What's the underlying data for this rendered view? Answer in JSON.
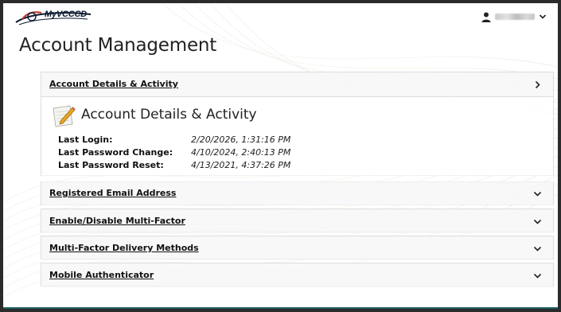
{
  "header": {
    "logo_text": "MyVCCCD",
    "user_name": "user_name_redacted"
  },
  "page": {
    "title": "Account Management"
  },
  "sections": [
    {
      "label": "Account Details & Activity",
      "expanded": true
    },
    {
      "label": "Registered Email Address",
      "expanded": false
    },
    {
      "label": "Enable/Disable Multi-Factor",
      "expanded": false
    },
    {
      "label": "Multi-Factor Delivery Methods",
      "expanded": false
    },
    {
      "label": "Mobile Authenticator",
      "expanded": false
    }
  ],
  "details": {
    "title": "Account Details & Activity",
    "rows": [
      {
        "label": "Last Login:",
        "value": "2/20/2026, 1:31:16 PM"
      },
      {
        "label": "Last Password Change:",
        "value": "4/10/2024, 2:40:13 PM"
      },
      {
        "label": "Last Password Reset:",
        "value": "4/13/2021, 4:37:26 PM"
      }
    ]
  },
  "icons": {
    "user": "user-icon",
    "chevron_down": "chevron-down-icon",
    "chevron_right": "chevron-right-icon",
    "notepad": "notepad-pencil-icon"
  },
  "colors": {
    "accent_teal": "#1f5f5f",
    "border": "#dcdcdc"
  }
}
